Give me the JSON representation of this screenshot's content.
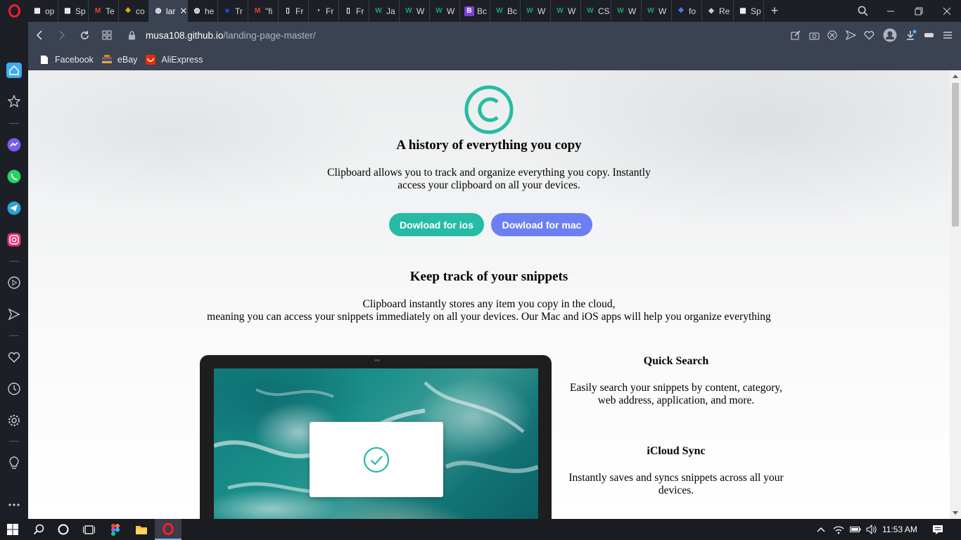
{
  "browser": {
    "tabs": [
      {
        "label": "op",
        "icon": "grid-icon",
        "color": "#ffffff"
      },
      {
        "label": "Sp",
        "icon": "grid-icon",
        "color": "#ffffff"
      },
      {
        "label": "Te",
        "icon": "gmail-icon",
        "color": "#ea4335"
      },
      {
        "label": "co",
        "icon": "colorful-icon",
        "color": "#f4b400"
      },
      {
        "label": "lar",
        "icon": "globe-icon",
        "color": "#ffffff",
        "active": true
      },
      {
        "label": "he",
        "icon": "globe-icon",
        "color": "#ffffff"
      },
      {
        "label": "Tr",
        "icon": "flag-icon",
        "color": "#1a4fd6"
      },
      {
        "label": "\"fi",
        "icon": "gmail-icon",
        "color": "#ea4335"
      },
      {
        "label": "Fr",
        "icon": "page-icon",
        "color": "#ffffff"
      },
      {
        "label": "Fr",
        "icon": "circle-icon",
        "color": "#ffffff"
      },
      {
        "label": "Fr",
        "icon": "page-icon",
        "color": "#ffffff"
      },
      {
        "label": "Ja",
        "icon": "w-icon",
        "color": "#1ea362"
      },
      {
        "label": "W",
        "icon": "w-icon",
        "color": "#1ea362"
      },
      {
        "label": "W",
        "icon": "w-icon",
        "color": "#1ea362"
      },
      {
        "label": "Bc",
        "icon": "b-icon",
        "color": "#7b3fe4"
      },
      {
        "label": "Bc",
        "icon": "w-icon",
        "color": "#1ea362"
      },
      {
        "label": "W",
        "icon": "w-icon",
        "color": "#1ea362"
      },
      {
        "label": "W",
        "icon": "w-icon",
        "color": "#1ea362"
      },
      {
        "label": "CS",
        "icon": "w-icon",
        "color": "#1ea362"
      },
      {
        "label": "W",
        "icon": "w-icon",
        "color": "#1ea362"
      },
      {
        "label": "W",
        "icon": "w-icon",
        "color": "#1ea362"
      },
      {
        "label": "fo",
        "icon": "colorful-icon",
        "color": "#4285f4"
      },
      {
        "label": "Re",
        "icon": "layers-icon",
        "color": "#cccccc"
      },
      {
        "label": "Sp",
        "icon": "grid-icon",
        "color": "#ffffff"
      }
    ],
    "url_host": "musa108.github.io",
    "url_path": "/landing-page-master/",
    "bookmarks": [
      {
        "label": "Facebook",
        "color": "#ffffff"
      },
      {
        "label": "eBay",
        "color": "#e53238"
      },
      {
        "label": "AliExpress",
        "color": "#e62e04"
      }
    ]
  },
  "page": {
    "hero": {
      "title": "A history of everything you copy",
      "text": "Clipboard allows you to track and organize everything you copy. Instantly access your clipboard on all your devices.",
      "btn_ios": "Dowload for ios",
      "btn_mac": "Dowload for mac"
    },
    "snippets": {
      "title": "Keep track of your snippets",
      "line1": "Clipboard instantly stores any item you copy in the cloud,",
      "line2": "meaning you can access your snippets immediately on all your devices. Our Mac and iOS apps will help you organize everything"
    },
    "features": [
      {
        "title": "Quick Search",
        "text": "Easily search your snippets by content, category, web address, application, and more."
      },
      {
        "title": "iCloud Sync",
        "text": "Instantly saves and syncs snippets across all your devices."
      }
    ],
    "colors": {
      "accent_teal": "#26bba4",
      "accent_blue": "#6c7ff2"
    }
  },
  "taskbar": {
    "time": "11:53 AM"
  }
}
